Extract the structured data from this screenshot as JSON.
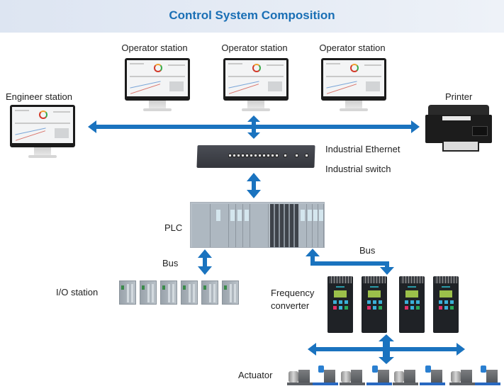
{
  "header": {
    "title": "Control System Composition"
  },
  "colors": {
    "accent": "#1a6fb5",
    "arrow": "#1a73bf",
    "header_bg": "#e3e9f3"
  },
  "nodes": {
    "operator_stations": [
      {
        "label": "Operator station",
        "icon": "monitor-icon"
      },
      {
        "label": "Operator station",
        "icon": "monitor-icon"
      },
      {
        "label": "Operator station",
        "icon": "monitor-icon"
      }
    ],
    "engineer_station": {
      "label": "Engineer station",
      "icon": "monitor-icon"
    },
    "printer": {
      "label": "Printer",
      "icon": "printer-icon"
    },
    "network": {
      "label": "Industrial Ethernet"
    },
    "switch": {
      "label": "Industrial switch",
      "icon": "network-switch-icon"
    },
    "plc": {
      "label": "PLC",
      "icon": "plc-icon"
    },
    "io_bus": {
      "label": "Bus"
    },
    "io_station": {
      "label": "I/O station",
      "icon": "io-module-icon",
      "count": 6
    },
    "vfd_bus": {
      "label": "Bus"
    },
    "frequency_converter": {
      "label_line1": "Frequency",
      "label_line2": "converter",
      "icon": "vfd-icon",
      "count": 4
    },
    "actuator": {
      "label": "Actuator",
      "icon": "pump-unit-icon",
      "count": 8
    }
  },
  "connections": [
    {
      "from": "engineer_station",
      "to": "printer",
      "type": "bidirectional",
      "medium": "Industrial Ethernet"
    },
    {
      "from": "operator_stations",
      "to": "switch",
      "type": "bidirectional"
    },
    {
      "from": "switch",
      "to": "plc",
      "type": "bidirectional"
    },
    {
      "from": "plc",
      "to": "io_station",
      "type": "bidirectional",
      "medium": "Bus"
    },
    {
      "from": "plc",
      "to": "frequency_converter",
      "type": "bidirectional",
      "medium": "Bus"
    },
    {
      "from": "frequency_converter",
      "to": "actuator",
      "type": "bidirectional"
    }
  ]
}
